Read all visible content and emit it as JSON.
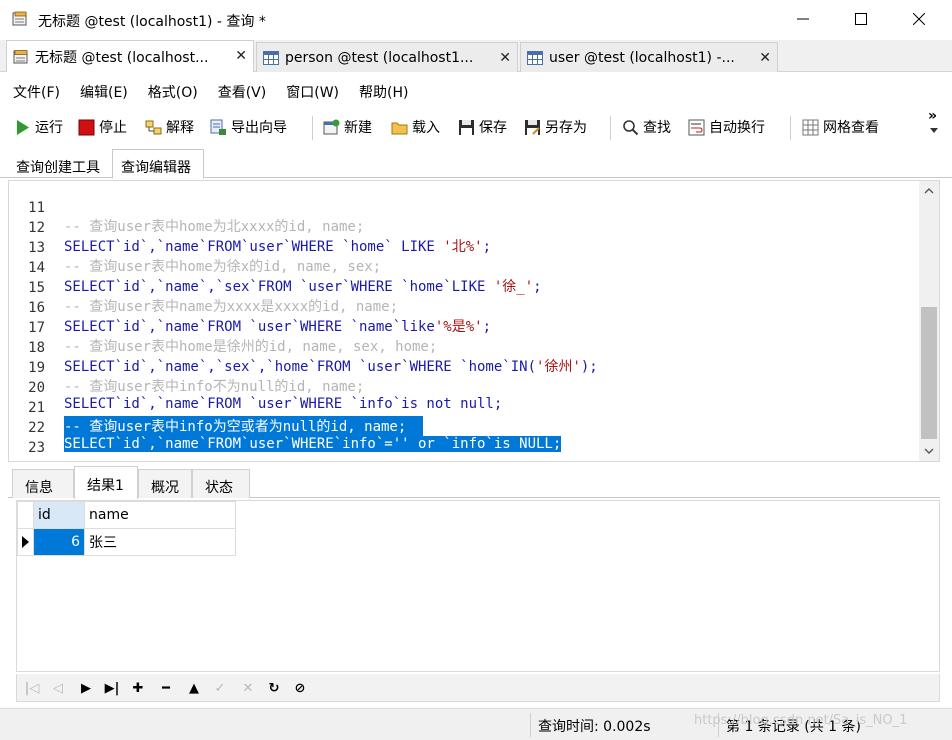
{
  "window": {
    "title": "无标题 @test (localhost1) - 查询 *",
    "icons": {
      "app": "query-file-icon",
      "minimize": "minimize-icon",
      "maximize": "maximize-icon",
      "close": "close-icon"
    }
  },
  "doc_tabs": [
    {
      "label": "无标题 @test (localhost...",
      "icon": "query-icon",
      "close": "✕"
    },
    {
      "label": "person @test (localhost1...",
      "icon": "table-icon",
      "close": "✕"
    },
    {
      "label": "user @test (localhost1) -...",
      "icon": "table-icon",
      "close": "✕"
    }
  ],
  "menu": [
    "文件(F)",
    "编辑(E)",
    "格式(O)",
    "查看(V)",
    "窗口(W)",
    "帮助(H)"
  ],
  "toolbar": {
    "run": "运行",
    "stop": "停止",
    "explain": "解释",
    "export_wizard": "导出向导",
    "new": "新建",
    "load": "载入",
    "save": "保存",
    "save_as": "另存为",
    "find": "查找",
    "word_wrap": "自动换行",
    "grid_view": "网格查看",
    "more": "»",
    "colors": {
      "run": "#2e9b2e",
      "stop": "#d01010"
    }
  },
  "sub_tabs": [
    "查询创建工具",
    "查询编辑器"
  ],
  "editor": {
    "lines": [
      {
        "no": "11",
        "type": "comment",
        "text": "-- 查询user表中home为北xxxx的id, name;"
      },
      {
        "no": "12",
        "type": "sql",
        "text": "SELECT`id`,`name`FROM`user`WHERE `home` LIKE ",
        "str": "'北%'",
        "tail": ";"
      },
      {
        "no": "13",
        "type": "comment",
        "text": "-- 查询user表中home为徐x的id, name, sex;"
      },
      {
        "no": "14",
        "type": "sql",
        "text": "SELECT`id`,`name`,`sex`FROM `user`WHERE `home`LIKE ",
        "str": "'徐_'",
        "tail": ";"
      },
      {
        "no": "15",
        "type": "comment",
        "text": "-- 查询user表中name为xxxx是xxxx的id, name;"
      },
      {
        "no": "16",
        "type": "sql",
        "text": "SELECT`id`,`name`FROM `user`WHERE `name`like",
        "str": "'%是%'",
        "tail": ";"
      },
      {
        "no": "17",
        "type": "comment",
        "text": "-- 查询user表中home是徐州的id, name, sex, home;"
      },
      {
        "no": "18",
        "type": "sql",
        "text": "SELECT`id`,`name`,`sex`,`home`FROM `user`WHERE `home`IN(",
        "str": "'徐州'",
        "tail": ");"
      },
      {
        "no": "19",
        "type": "comment",
        "text": "-- 查询user表中info不为null的id, name;"
      },
      {
        "no": "20",
        "type": "sql",
        "text": "SELECT`id`,`name`FROM `user`WHERE `info`is not null;",
        "str": "",
        "tail": ""
      },
      {
        "no": "21",
        "type": "highlight",
        "text": "-- 查询user表中info为空或者为null的id, name;  "
      },
      {
        "no": "22",
        "type": "highlight",
        "text": "SELECT`id`,`name`FROM`user`WHERE`info`='' or `info`is NULL;"
      },
      {
        "no": "23",
        "type": "empty",
        "text": ""
      }
    ]
  },
  "result_tabs": [
    "信息",
    "结果1",
    "概况",
    "状态"
  ],
  "result_grid": {
    "columns": [
      "id",
      "name"
    ],
    "rows": [
      {
        "id": "6",
        "name": "张三"
      }
    ]
  },
  "navigator": {
    "buttons": [
      "first-icon",
      "prev-icon",
      "next-icon",
      "last-icon",
      "add-icon",
      "delete-icon",
      "apply-icon",
      "discard-icon",
      "cancel-icon",
      "refresh-icon",
      "stop-icon"
    ],
    "glyphs": [
      "|◁",
      "◁",
      "▶",
      "▶|",
      "✚",
      "━",
      "▲",
      "✓",
      "✕",
      "↻",
      "⊘"
    ]
  },
  "status": {
    "query_time": "查询时间: 0.002s",
    "records": "第 1 条记录 (共 1 条)",
    "watermark": "https://blog.csdn.net/Sa_is_NO_1"
  }
}
